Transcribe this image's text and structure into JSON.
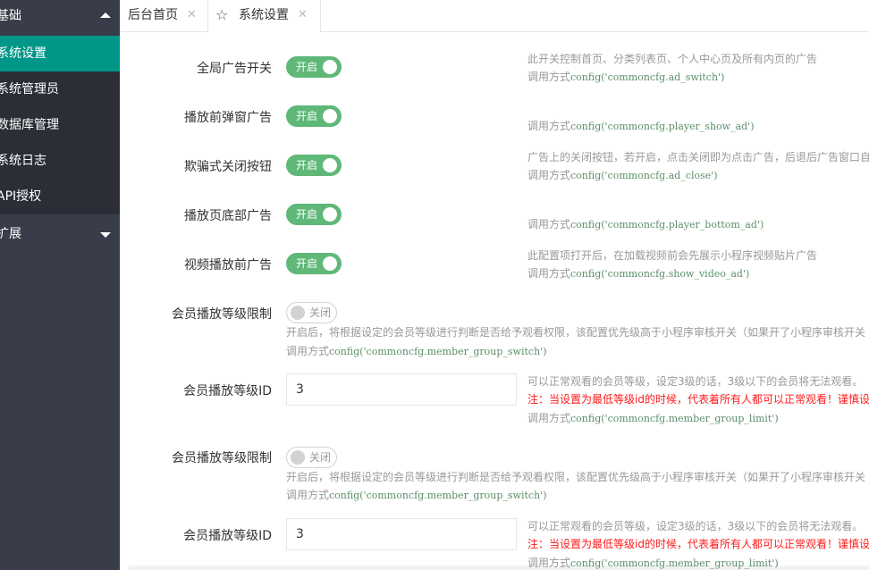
{
  "sidebar": {
    "group_basic": "基础",
    "items": [
      {
        "label": "系统设置",
        "active": true
      },
      {
        "label": "系统管理员",
        "active": false
      },
      {
        "label": "数据库管理",
        "active": false
      },
      {
        "label": "系统日志",
        "active": false
      },
      {
        "label": "API授权",
        "active": false
      }
    ],
    "group_ext": "扩展"
  },
  "tabs": [
    {
      "label": "后台首页",
      "close": "✕"
    },
    {
      "label": "系统设置",
      "close": "✕",
      "icon": "star-icon"
    }
  ],
  "settings": [
    {
      "label": "全局广告开关",
      "switch": "开启",
      "on": true,
      "desc": "此开关控制首页、分类列表页、个人中心页及所有内页的广告",
      "call_prefix": "调用方式",
      "call_code": "config('commoncfg.ad_switch')"
    },
    {
      "label": "播放前弹窗广告",
      "switch": "开启",
      "on": true,
      "desc": "",
      "call_prefix": "调用方式",
      "call_code": "config('commoncfg.player_show_ad')"
    },
    {
      "label": "欺骗式关闭按钮",
      "switch": "开启",
      "on": true,
      "desc": "广告上的关闭按钮，若开启，点击关闭即为点击广告，后退后广告窗口自",
      "call_prefix": "调用方式",
      "call_code": "config('commoncfg.ad_close')"
    },
    {
      "label": "播放页底部广告",
      "switch": "开启",
      "on": true,
      "desc": "",
      "call_prefix": "调用方式",
      "call_code": "config('commoncfg.player_bottom_ad')"
    },
    {
      "label": "视频播放前广告",
      "switch": "开启",
      "on": true,
      "desc": "此配置项打开后，在加载视频前会先展示小程序视频贴片广告",
      "call_prefix": "调用方式",
      "call_code": "config('commoncfg.show_video_ad')"
    }
  ],
  "member_blocks": [
    {
      "limit_label": "会员播放等级限制",
      "switch": "关闭",
      "desc": "开启后，将根据设定的会员等级进行判断是否给予观看权限，该配置优先级高于小程序审核开关（如果开了小程序审核开关",
      "call_prefix": "调用方式",
      "call_code": "config('commoncfg.member_group_switch')",
      "id_label": "会员播放等级ID",
      "id_value": "3",
      "id_desc": "可以正常观看的会员等级，设定3级的话，3级以下的会员将无法观看。",
      "id_warn": "注：当设置为最低等级id的时候，代表着所有人都可以正常观看！谨慎设",
      "id_call_prefix": "调用方式",
      "id_call_code": "config('commoncfg.member_group_limit')"
    },
    {
      "limit_label": "会员播放等级限制",
      "switch": "关闭",
      "desc": "开启后，将根据设定的会员等级进行判断是否给予观看权限，该配置优先级高于小程序审核开关（如果开了小程序审核开关",
      "call_prefix": "调用方式",
      "call_code": "config('commoncfg.member_group_switch')",
      "id_label": "会员播放等级ID",
      "id_value": "3",
      "id_desc": "可以正常观看的会员等级，设定3级的话，3级以下的会员将无法观看。",
      "id_warn": "注：当设置为最低等级id的时候，代表着所有人都可以正常观看！谨慎设",
      "id_call_prefix": "调用方式",
      "id_call_code": "config('commoncfg.member_group_limit')"
    }
  ],
  "colors": {
    "accent": "#009688",
    "switch_on": "#5fb878",
    "sidebar": "#393d49",
    "warn": "#ff1a1a"
  }
}
